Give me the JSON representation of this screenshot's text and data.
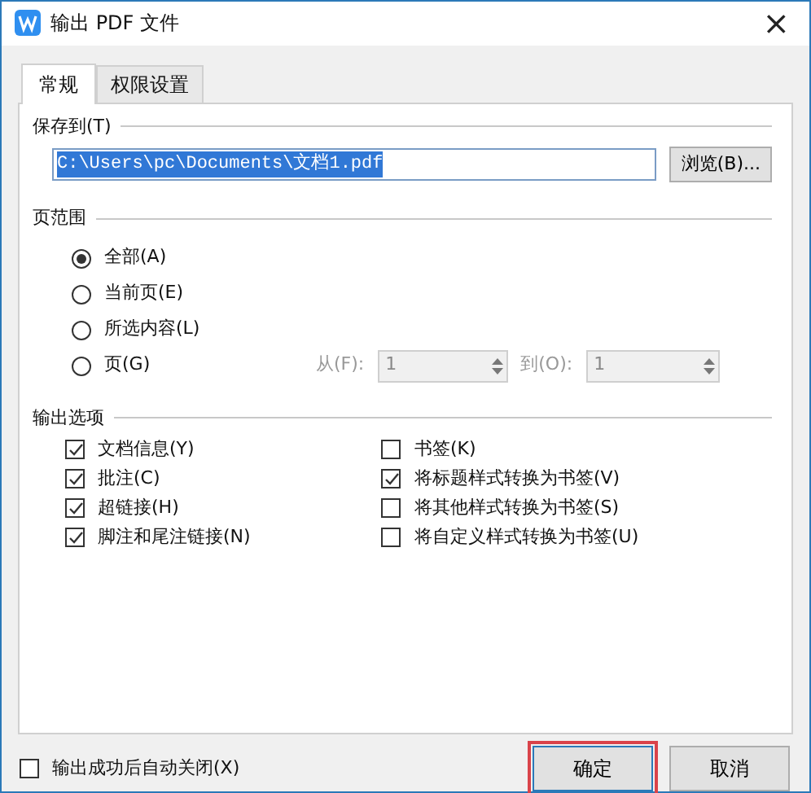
{
  "window": {
    "title": "输出 PDF 文件",
    "close": "×"
  },
  "tabs": [
    {
      "label": "常规",
      "selected": true
    },
    {
      "label": "权限设置",
      "selected": false
    }
  ],
  "save_to": {
    "label": "保存到(T)",
    "value": "C:\\Users\\pc\\Documents\\文档1.pdf",
    "value_selected": true,
    "browse": "浏览(B)..."
  },
  "page_range": {
    "label": "页范围",
    "options": [
      {
        "label": "全部(A)",
        "selected": true
      },
      {
        "label": "当前页(E)",
        "selected": false
      },
      {
        "label": "所选内容(L)",
        "selected": false
      },
      {
        "label": "页(G)",
        "selected": false
      }
    ],
    "from": {
      "label": "从(F):",
      "value": "1",
      "disabled": true
    },
    "to": {
      "label": "到(O):",
      "value": "1",
      "disabled": true
    }
  },
  "output_options": {
    "label": "输出选项",
    "left": [
      {
        "label": "文档信息(Y)",
        "checked": true
      },
      {
        "label": "批注(C)",
        "checked": true
      },
      {
        "label": "超链接(H)",
        "checked": true
      },
      {
        "label": "脚注和尾注链接(N)",
        "checked": true
      }
    ],
    "right": [
      {
        "label": "书签(K)",
        "checked": false
      },
      {
        "label": "将标题样式转换为书签(V)",
        "checked": true
      },
      {
        "label": "将其他样式转换为书签(S)",
        "checked": false
      },
      {
        "label": "将自定义样式转换为书签(U)",
        "checked": false
      }
    ]
  },
  "auto_close": {
    "label": "输出成功后自动关闭(X)",
    "checked": false
  },
  "buttons": [
    {
      "label": "确定",
      "highlighted": true
    },
    {
      "label": "取消",
      "highlighted": false
    }
  ]
}
